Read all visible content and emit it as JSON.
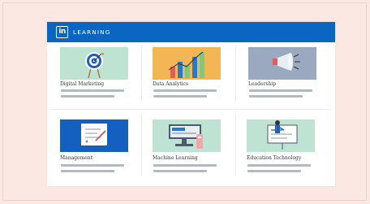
{
  "header": {
    "logo_text": "in",
    "brand": "LEARNING"
  },
  "courses": [
    {
      "title": "Digital Marketing",
      "thumb_bg": "#bfe3d3",
      "icon": "target-icon"
    },
    {
      "title": "Data Analytics",
      "thumb_bg": "#f3b654",
      "icon": "bar-chart-icon"
    },
    {
      "title": "Leadership",
      "thumb_bg": "#9aa9c0",
      "icon": "megaphone-icon"
    },
    {
      "title": "Management",
      "thumb_bg": "#1360c1",
      "icon": "presentation-board-icon"
    },
    {
      "title": "Machine Learning",
      "thumb_bg": "#bfe3d3",
      "icon": "workstation-icon"
    },
    {
      "title": "Education Technology",
      "thumb_bg": "#bfe3d3",
      "icon": "teacher-whiteboard-icon"
    }
  ],
  "colors": {
    "page_bg": "#fbe8e2",
    "header_bg": "#0a66c2",
    "placeholder_line": "#aebcc0"
  }
}
